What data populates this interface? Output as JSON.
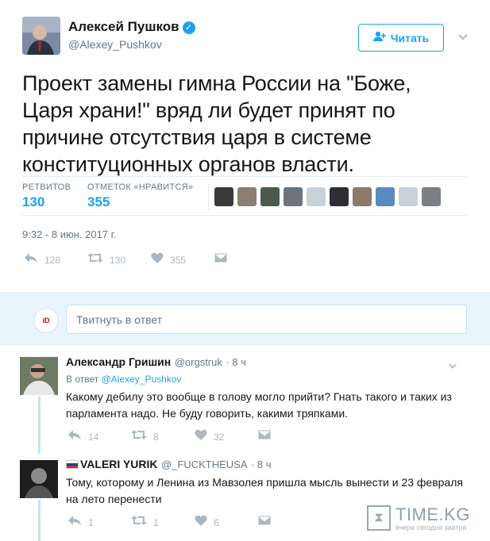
{
  "tweet": {
    "author_name": "Алексей Пушков",
    "author_handle": "@Alexey_Pushkov",
    "follow_label": "Читать",
    "text": "Проект замены гимна России на \"Боже, Царя храни!\" вряд ли будет принят по причине отсутствия царя в системе конституционных органов власти.",
    "retweets_label": "РЕТВИТОВ",
    "retweets_count": "130",
    "likes_label": "ОТМЕТОК «НРАВИТСЯ»",
    "likes_count": "355",
    "date": "9:32 - 8 июн. 2017 г.",
    "actions": {
      "reply": "128",
      "retweet": "130",
      "like": "355"
    }
  },
  "reply_box": {
    "placeholder": "Твитнуть в ответ",
    "logo_text": "iD"
  },
  "replies": [
    {
      "name": "Александр Гришин",
      "handle": "@orgstruk",
      "time": "· 8 ч",
      "in_reply_prefix": "В ответ",
      "in_reply_handle": "@Alexey_Pushkov",
      "text": "Какому дебилу это вообще в голову могло прийти? Гнать такого и таких из парламента надо. Не буду говорить, какими тряпками.",
      "actions": {
        "reply": "14",
        "retweet": "8",
        "like": "32"
      }
    },
    {
      "name": "VALERI YURIK",
      "handle": "@_FUCKTHEUSA",
      "time": "· 8 ч",
      "text": "Тому, которому и Ленина из Мавзолея пришла мысль вынести и 23 февраля на лето перенести",
      "actions": {
        "reply": "1",
        "retweet": "1",
        "like": "6"
      }
    }
  ],
  "watermark": {
    "title": "TIME.KG",
    "subtitle": "вчера сегодня завтра"
  },
  "colors": {
    "accent": "#1da1f2",
    "muted": "#657786",
    "reply_band": "#e8f5fd"
  }
}
